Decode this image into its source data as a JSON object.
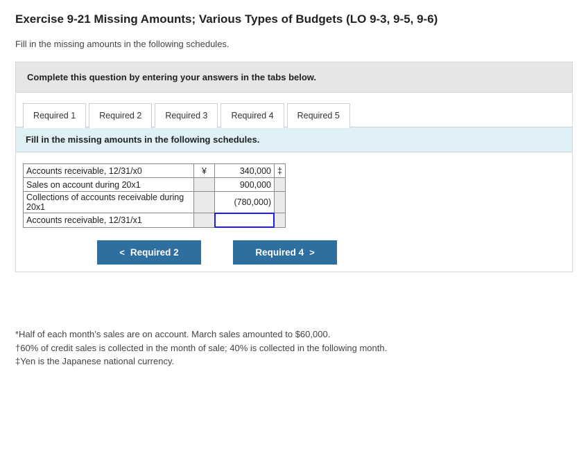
{
  "title": "Exercise 9-21 Missing Amounts; Various Types of Budgets (LO 9-3, 9-5, 9-6)",
  "intro": "Fill in the missing amounts in the following schedules.",
  "complete_bar": "Complete this question by entering your answers in the tabs below.",
  "tabs": [
    {
      "label": "Required 1",
      "active": false
    },
    {
      "label": "Required 2",
      "active": false
    },
    {
      "label": "Required 3",
      "active": true
    },
    {
      "label": "Required 4",
      "active": false
    },
    {
      "label": "Required 5",
      "active": false
    }
  ],
  "sub_instruction": "Fill in the missing amounts in the following schedules.",
  "sheet": {
    "rows": [
      {
        "label": "Accounts receivable, 12/31/x0",
        "currency": "¥",
        "value": "340,000",
        "symbol": "‡"
      },
      {
        "label": "Sales on account during 20x1",
        "currency": "",
        "value": "900,000",
        "symbol": ""
      },
      {
        "label": "Collections of accounts receivable during 20x1",
        "currency": "",
        "value": "(780,000)",
        "symbol": ""
      },
      {
        "label": "Accounts receivable, 12/31/x1",
        "currency": "",
        "value": "",
        "symbol": "",
        "input": true
      }
    ]
  },
  "nav": {
    "prev_chevron": "<",
    "prev": "Required 2",
    "next": "Required 4",
    "next_chevron": ">"
  },
  "footnotes": {
    "a": "*Half of each month’s sales are on account. March sales amounted to $60,000.",
    "b": "†60% of credit sales is collected in the month of sale; 40% is collected in the following month.",
    "c": "‡Yen is the Japanese national currency."
  }
}
